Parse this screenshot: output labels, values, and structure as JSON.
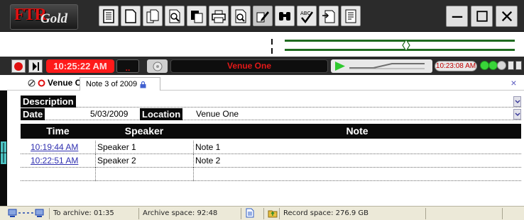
{
  "app": {
    "logo_main": "FTR",
    "logo_sub": "Gold"
  },
  "toolbar": {
    "buttons": [
      {
        "name": "notes-list-icon"
      },
      {
        "name": "new-document-icon"
      },
      {
        "name": "copy-document-icon"
      },
      {
        "name": "search-document-icon"
      },
      {
        "name": "paste-icon"
      },
      {
        "name": "printer-icon"
      },
      {
        "name": "print-preview-icon"
      },
      {
        "name": "edit-pen-icon"
      },
      {
        "name": "binoculars-icon"
      },
      {
        "name": "spellcheck-icon"
      },
      {
        "name": "export-document-icon"
      },
      {
        "name": "report-icon"
      }
    ],
    "window_buttons": {
      "minimize": "—",
      "maximize": "☐",
      "close": "X"
    }
  },
  "transport": {
    "current_time": "10:25:22 AM",
    "red_indicator": "..",
    "venue": "Venue One",
    "playback_time": "10:23:08 AM"
  },
  "tabs": {
    "venue_tab": "Venue One",
    "note_tab": "Note 3 of 2009"
  },
  "fields": {
    "description_label": "Description",
    "description_value": "",
    "date_label": "Date",
    "date_value": "5/03/2009",
    "location_label": "Location",
    "location_value": "Venue One"
  },
  "notes_table": {
    "headers": [
      "Time",
      "Speaker",
      "Note"
    ],
    "rows": [
      {
        "time": "10:19:44 AM",
        "speaker": "Speaker 1",
        "note": "Note 1"
      },
      {
        "time": "10:22:51 AM",
        "speaker": "Speaker 2",
        "note": "Note 2"
      }
    ]
  },
  "status": {
    "to_archive": "To archive: 01:35",
    "archive_space": "Archive space: 92:48",
    "record_space": "Record space: 276.9 GB"
  },
  "colors": {
    "toolbar_bg": "#2b2b2b",
    "clock_red": "#ff1a1a",
    "venue_red": "#e21818",
    "meter_green": "#1f6b1f",
    "link_blue": "#3030b0",
    "status_green": "#39d439"
  }
}
